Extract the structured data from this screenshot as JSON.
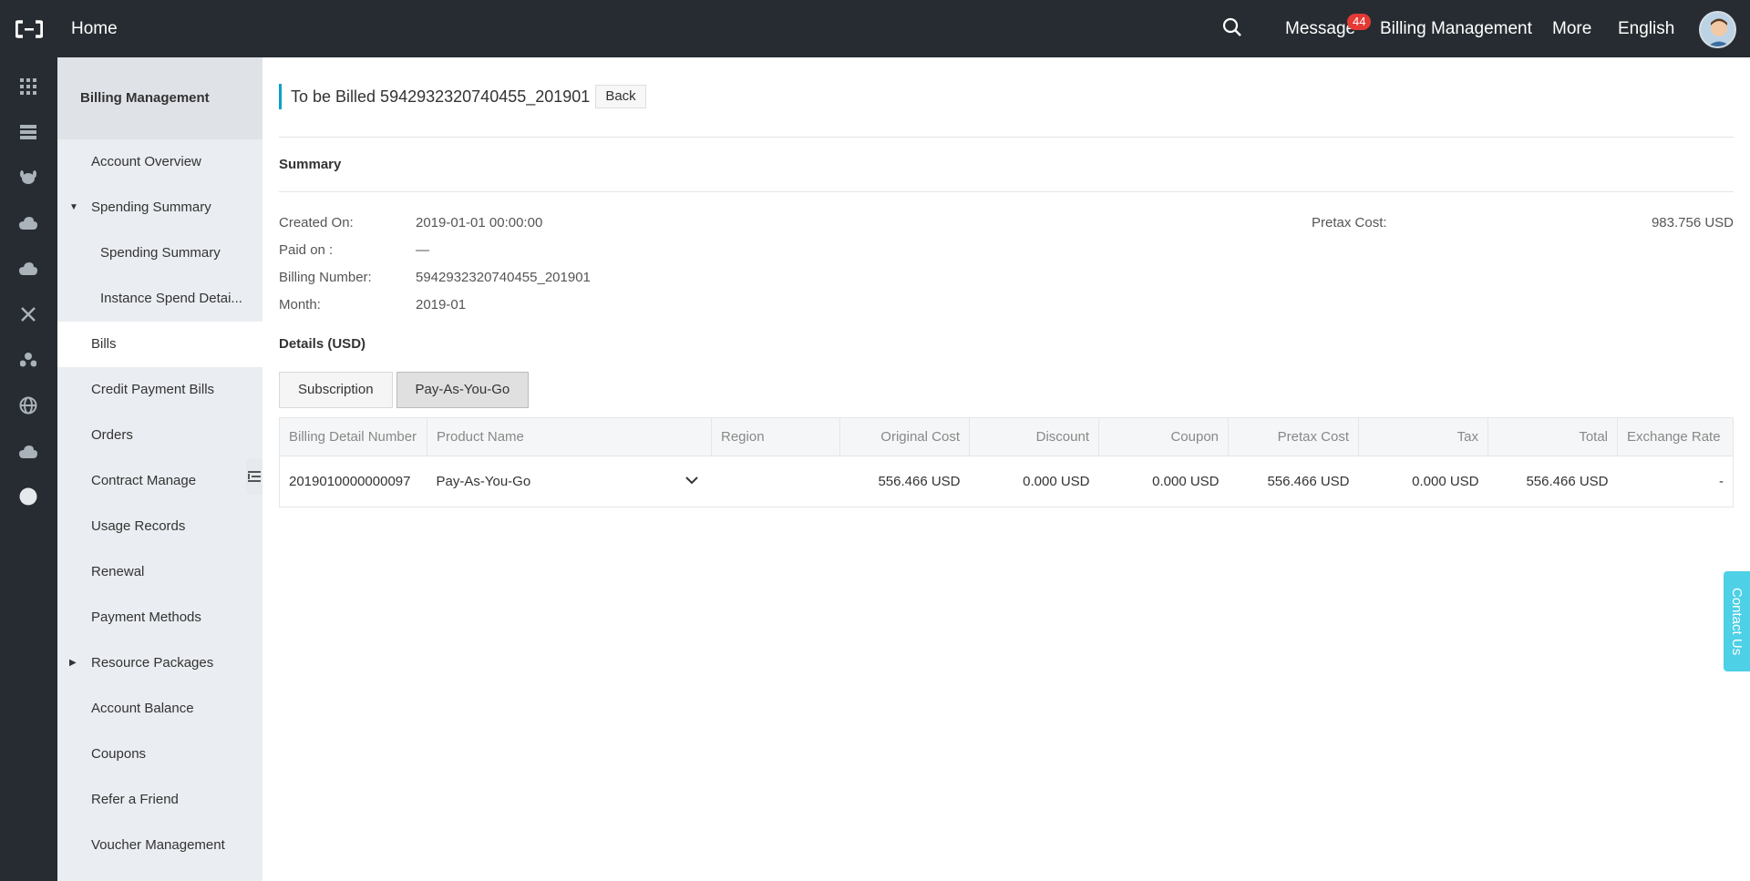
{
  "topbar": {
    "home": "Home",
    "message": "Message",
    "message_badge": "44",
    "billing": "Billing Management",
    "more": "More",
    "language": "English"
  },
  "rail_icons": [
    "grid-icon",
    "server-icon",
    "dog-icon",
    "cloud-icon",
    "cloud-upload-icon",
    "nodes-icon",
    "cluster-icon",
    "globe-icon",
    "settings-cloud-icon",
    "circle-icon"
  ],
  "sidebar": {
    "title": "Billing Management",
    "items": [
      {
        "label": "Account Overview"
      },
      {
        "label": "Spending Summary"
      },
      {
        "label": "Spending Summary"
      },
      {
        "label": "Instance Spend Detai..."
      },
      {
        "label": "Bills"
      },
      {
        "label": "Credit Payment Bills"
      },
      {
        "label": "Orders"
      },
      {
        "label": "Contract Manage"
      },
      {
        "label": "Usage Records"
      },
      {
        "label": "Renewal"
      },
      {
        "label": "Payment Methods"
      },
      {
        "label": "Resource Packages"
      },
      {
        "label": "Account Balance"
      },
      {
        "label": "Coupons"
      },
      {
        "label": "Refer a Friend"
      },
      {
        "label": "Voucher Management"
      }
    ]
  },
  "page": {
    "title": "To be Billed 5942932320740455_201901",
    "back": "Back",
    "summary_title": "Summary",
    "created_k": "Created On:",
    "created_v": "2019-01-01 00:00:00",
    "paid_k": "Paid on :",
    "paid_v": "—",
    "billing_k": "Billing Number:",
    "billing_v": "5942932320740455_201901",
    "month_k": "Month:",
    "month_v": "2019-01",
    "pretax_k": "Pretax Cost:",
    "pretax_v": "983.756 USD",
    "details_title": "Details (USD)",
    "tab_subscription": "Subscription",
    "tab_payg": "Pay-As-You-Go"
  },
  "table": {
    "headers": [
      "Billing Detail Number",
      "Product Name",
      "Region",
      "Original Cost",
      "Discount",
      "Coupon",
      "Pretax Cost",
      "Tax",
      "Total",
      "Exchange Rate"
    ],
    "row": {
      "number": "2019010000000097",
      "product": "Pay-As-You-Go",
      "region": "",
      "original": "556.466 USD",
      "discount": "0.000 USD",
      "coupon": "0.000 USD",
      "pretax": "556.466 USD",
      "tax": "0.000 USD",
      "total": "556.466 USD",
      "rate": "-"
    }
  },
  "contact": "Contact Us",
  "colors": {
    "topbar": "#262c31",
    "sidebar": "#eaedf1",
    "accent": "#00a2ca",
    "badge": "#e53935",
    "contact": "#4ed0e6"
  }
}
